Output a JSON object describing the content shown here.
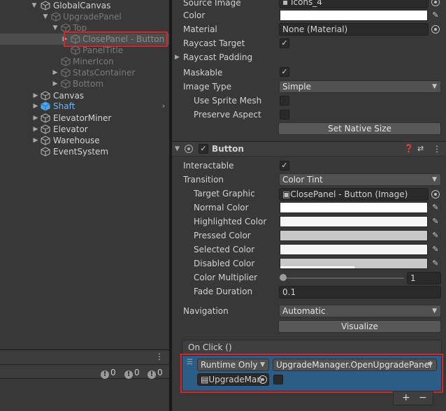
{
  "hierarchy": {
    "items": [
      {
        "label": "GlobalCanvas",
        "expanded": true
      },
      {
        "label": "UpgradePanel",
        "expanded": true,
        "dim": true
      },
      {
        "label": "Top",
        "expanded": true,
        "dim": true
      },
      {
        "label": "ClosePanel - Button",
        "selected": true
      },
      {
        "label": "PanelTitle",
        "dim": true
      },
      {
        "label": "MinerIcon",
        "dim": true
      },
      {
        "label": "StatsContainer",
        "dim": true
      },
      {
        "label": "Bottom",
        "dim": true
      },
      {
        "label": "Canvas"
      },
      {
        "label": "Shaft",
        "highlight": true
      },
      {
        "label": "ElevatorMiner"
      },
      {
        "label": "Elevator"
      },
      {
        "label": "Warehouse"
      },
      {
        "label": "EventSystem"
      }
    ]
  },
  "console": {
    "errors": "0",
    "warnings": "0",
    "messages": "0"
  },
  "image": {
    "source_image_label": "Source Image",
    "source_image_value": "Icons_4",
    "color_label": "Color",
    "material_label": "Material",
    "material_value": "None (Material)",
    "raycast_target_label": "Raycast Target",
    "raycast_padding_label": "Raycast Padding",
    "maskable_label": "Maskable",
    "image_type_label": "Image Type",
    "image_type_value": "Simple",
    "use_sprite_mesh_label": "Use Sprite Mesh",
    "preserve_aspect_label": "Preserve Aspect",
    "set_native_size_label": "Set Native Size"
  },
  "button": {
    "title": "Button",
    "interactable_label": "Interactable",
    "transition_label": "Transition",
    "transition_value": "Color Tint",
    "target_graphic_label": "Target Graphic",
    "target_graphic_value": "ClosePanel - Button (Image)",
    "normal_color_label": "Normal Color",
    "highlighted_color_label": "Highlighted Color",
    "pressed_color_label": "Pressed Color",
    "selected_color_label": "Selected Color",
    "disabled_color_label": "Disabled Color",
    "color_multiplier_label": "Color Multiplier",
    "color_multiplier_value": "1",
    "fade_duration_label": "Fade Duration",
    "fade_duration_value": "0.1",
    "navigation_label": "Navigation",
    "navigation_value": "Automatic",
    "visualize_label": "Visualize"
  },
  "onclick": {
    "header": "On Click ()",
    "runtime_value": "Runtime Only",
    "function_value": "UpgradeManager.OpenUpgradePanel",
    "object_value": "UpgradeMan",
    "add_label": "+",
    "remove_label": "−"
  },
  "colors": {
    "selection_box": "#d7262c",
    "event_row_bg": "#2c5d87",
    "highlight_text": "#6cb4f0"
  }
}
